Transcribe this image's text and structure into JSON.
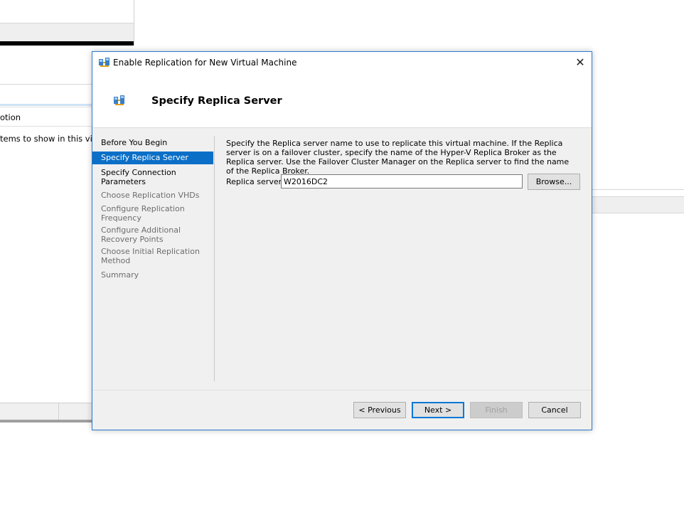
{
  "background": {
    "column_header": "otion",
    "empty_message": "tems to show in this view."
  },
  "dialog": {
    "title": "Enable Replication for New Virtual Machine",
    "close_label": "✕",
    "header_title": "Specify Replica Server",
    "nav": [
      {
        "label": "Before You Begin",
        "state": "done"
      },
      {
        "label": "Specify Replica Server",
        "state": "selected"
      },
      {
        "label": "Specify Connection Parameters",
        "state": "enabled"
      },
      {
        "label": "Choose Replication VHDs",
        "state": "disabled"
      },
      {
        "label": "Configure Replication Frequency",
        "state": "disabled"
      },
      {
        "label": "Configure Additional Recovery Points",
        "state": "disabled"
      },
      {
        "label": "Choose Initial Replication Method",
        "state": "disabled"
      },
      {
        "label": "Summary",
        "state": "disabled"
      }
    ],
    "description": "Specify the Replica server name to use to replicate this virtual machine. If the Replica server is on a failover cluster, specify the name of the Hyper-V Replica Broker as the Replica server. Use the Failover Cluster Manager on the Replica server to find the name of the Replica Broker.",
    "replica_server_label": "Replica server:",
    "replica_server_value": "W2016DC2",
    "browse_label": "Browse...",
    "buttons": {
      "previous": "< Previous",
      "next": "Next >",
      "finish": "Finish",
      "cancel": "Cancel"
    },
    "colors": {
      "accent": "#0b6fc7",
      "border": "#2b7ad0"
    }
  }
}
